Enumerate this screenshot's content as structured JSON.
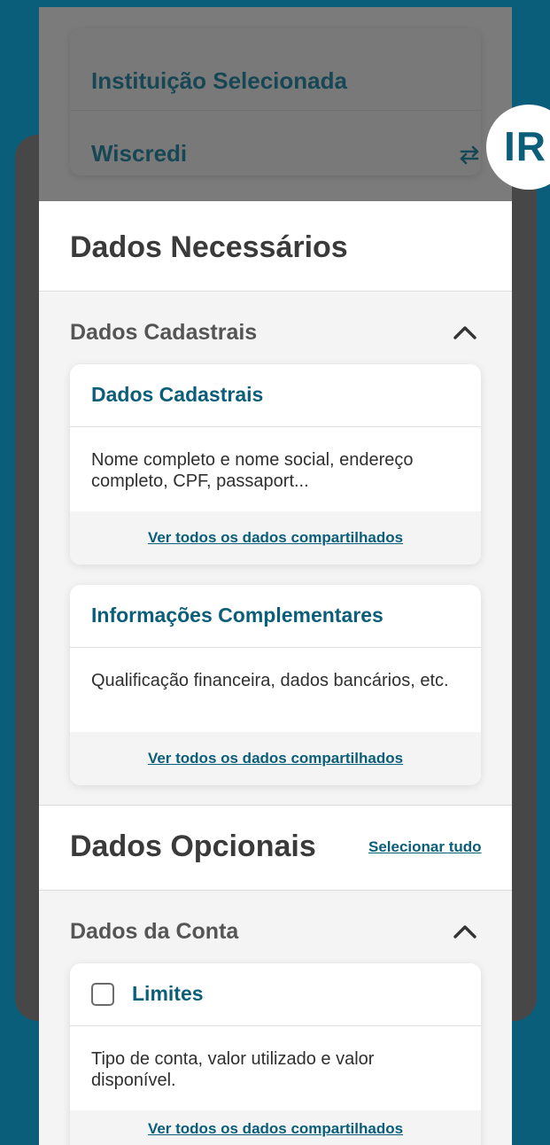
{
  "institution": {
    "label": "Instituição Selecionada",
    "value": "Wiscredi",
    "swap_icon": "swap-arrows-icon"
  },
  "badge": {
    "text": "IR"
  },
  "required": {
    "title": "Dados Necessários",
    "group_title": "Dados Cadastrais",
    "cards": [
      {
        "title": "Dados Cadastrais",
        "description": "Nome completo e nome social, endereço completo, CPF, passaport...",
        "link": "Ver todos os dados compartilhados"
      },
      {
        "title": "Informações Complementares",
        "description": "Qualificação financeira, dados bancários, etc.",
        "link": "Ver todos os dados compartilhados"
      }
    ]
  },
  "optional": {
    "title": "Dados Opcionais",
    "select_all": "Selecionar tudo",
    "group_title": "Dados da Conta",
    "cards": [
      {
        "title": "Limites",
        "description": "Tipo de conta, valor utilizado e valor disponível.",
        "link": "Ver todos os dados compartilhados",
        "checked": false
      }
    ]
  },
  "colors": {
    "brand": "#0B5E79",
    "frame": "#474747",
    "dim_overlay": "#7b7b7b"
  }
}
